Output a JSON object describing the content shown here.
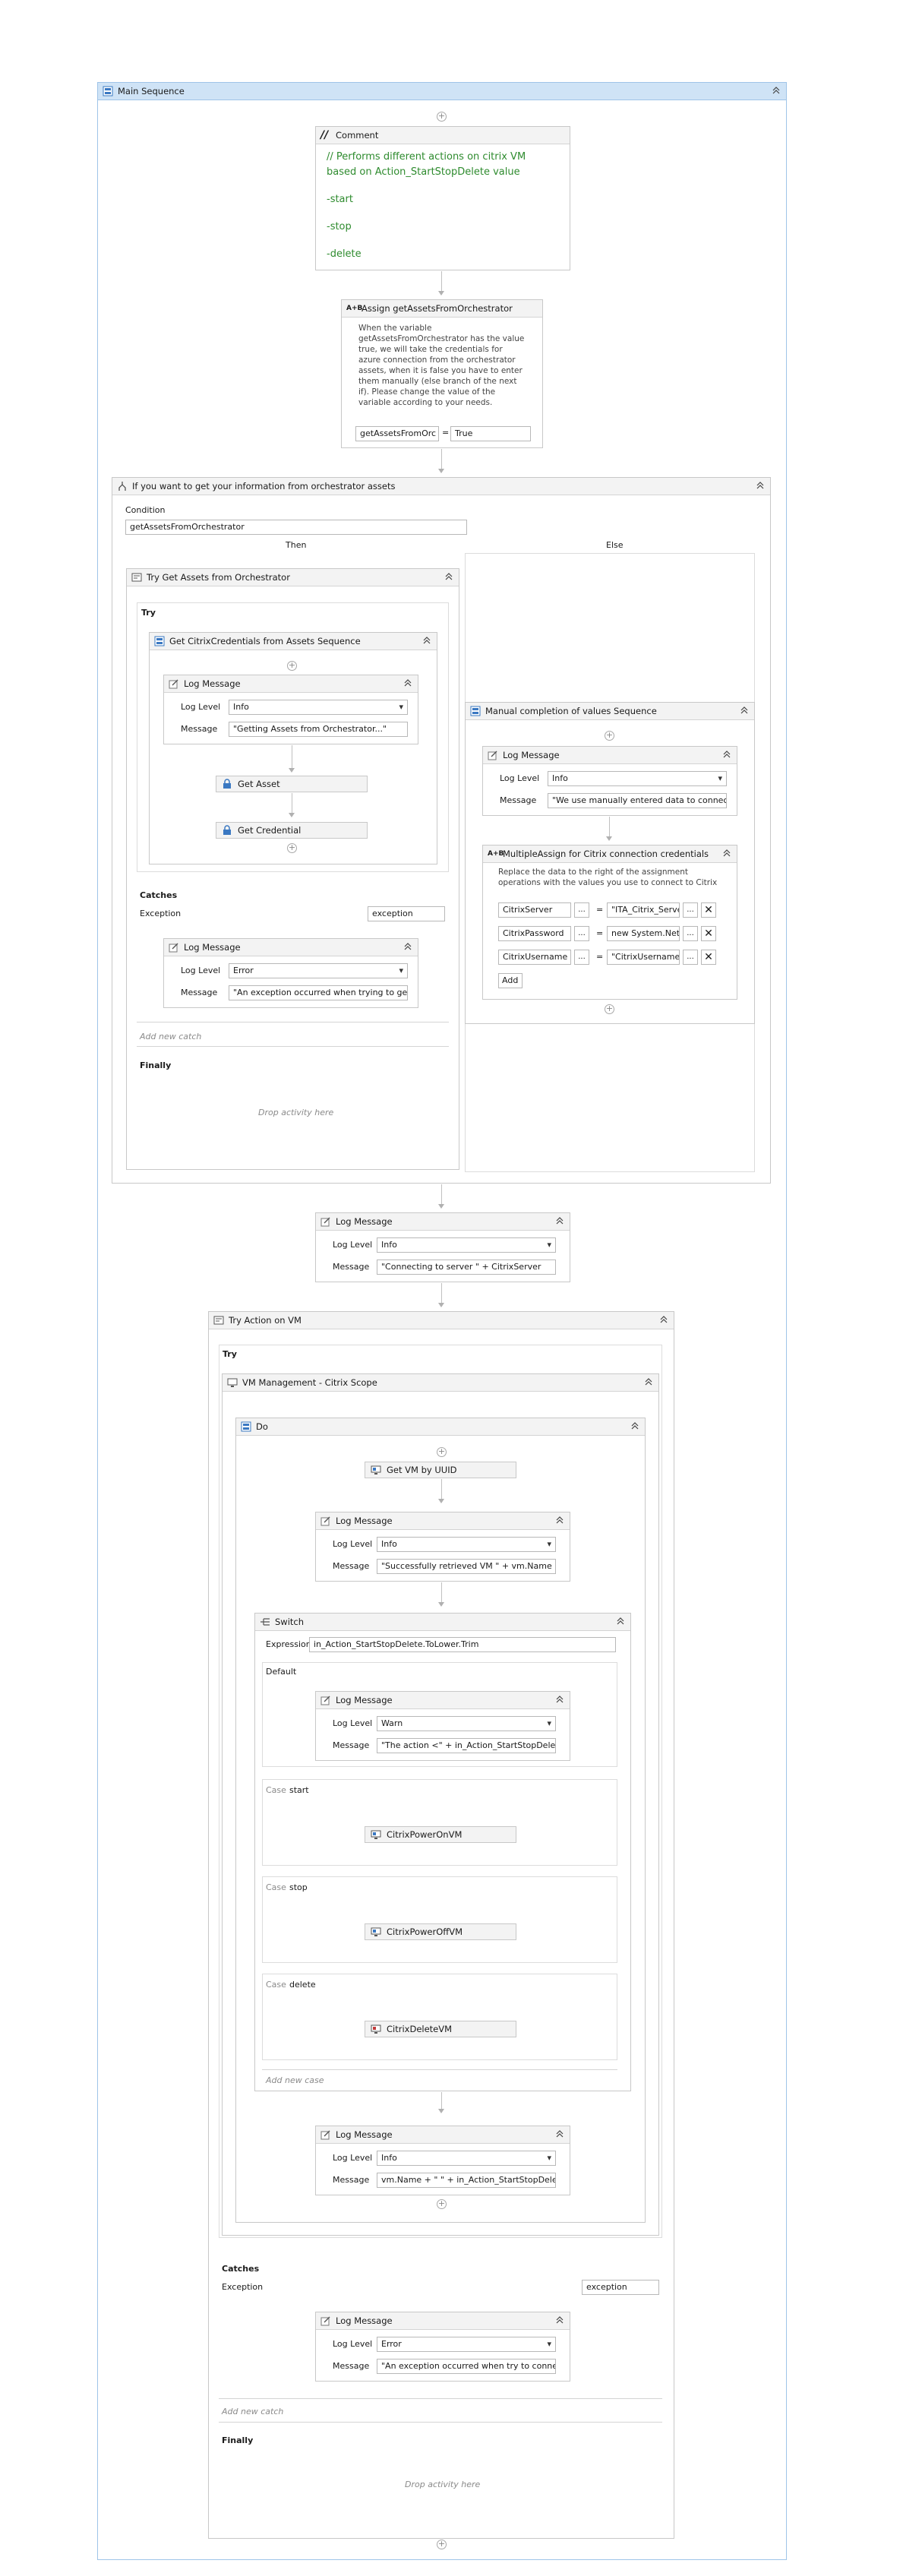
{
  "main": {
    "title": "Main Sequence"
  },
  "comment": {
    "title": "Comment",
    "lines": [
      "// Performs different actions on citrix VM",
      "based on Action_StartStopDelete value",
      "-start",
      "-stop",
      "-delete"
    ]
  },
  "assign": {
    "title": "Assign getAssetsFromOrchestrator",
    "description": "When the variable getAssetsFromOrchestrator has the value true, we will take the credentials for azure connection from the orchestrator assets, when it is false you have to enter them manually (else branch of the next if). Please change the value of the variable according to your needs.",
    "to": "getAssetsFromOrc",
    "op": "=",
    "value": "True"
  },
  "if": {
    "title": "If you want to get your information from orchestrator assets",
    "condition_label": "Condition",
    "condition": "getAssetsFromOrchestrator",
    "then_label": "Then",
    "else_label": "Else"
  },
  "try1": {
    "title": "Try Get Assets from Orchestrator",
    "try_label": "Try",
    "seq_title": "Get CitrixCredentials from Assets Sequence",
    "log": {
      "title": "Log Message",
      "level_label": "Log Level",
      "level": "Info",
      "message_label": "Message",
      "message": "\"Getting Assets from Orchestrator...\""
    },
    "get_asset": "Get Asset",
    "get_credential": "Get Credential",
    "catches_label": "Catches",
    "exception_label": "Exception",
    "exception_value": "exception",
    "catch_log": {
      "title": "Log Message",
      "level_label": "Log Level",
      "level": "Error",
      "message_label": "Message",
      "message": "\"An exception occurred when trying to get"
    },
    "add_catch": "Add new catch",
    "finally_label": "Finally",
    "drop_here": "Drop activity here"
  },
  "else_seq": {
    "title": "Manual completion of values Sequence",
    "log": {
      "title": "Log Message",
      "level_label": "Log Level",
      "level": "Info",
      "message_label": "Message",
      "message": "\"We use manually entered data to connect"
    },
    "multi": {
      "title": "MultipleAssign for  Citrix connection credentials",
      "description": "Replace the data to the right of the assignment operations with the values you use to connect to Citrix",
      "rows": [
        {
          "to": "CitrixServer",
          "value": "\"ITA_Citrix_Serve"
        },
        {
          "to": "CitrixPassword",
          "value": "new System.Net"
        },
        {
          "to": "CitrixUsername",
          "value": "\"CitrixUsername"
        }
      ],
      "dots": "...",
      "eq": "=",
      "add": "Add"
    }
  },
  "log_connect": {
    "title": "Log Message",
    "level_label": "Log Level",
    "level": "Info",
    "message_label": "Message",
    "message": "\"Connecting to server \" + CitrixServer"
  },
  "try2": {
    "title": "Try Action on VM",
    "try_label": "Try",
    "scope_title": "VM Management - Citrix Scope",
    "do_title": "Do",
    "get_vm": "Get VM by UUID",
    "log_retrieved": {
      "title": "Log Message",
      "level_label": "Log Level",
      "level": "Info",
      "message_label": "Message",
      "message": "\"Successfully retrieved VM \" + vm.Name +"
    },
    "switch": {
      "title": "Switch",
      "expression_label": "Expression",
      "expression": "in_Action_StartStopDelete.ToLower.Trim",
      "default_label": "Default",
      "default_log": {
        "title": "Log Message",
        "level_label": "Log Level",
        "level": "Warn",
        "message_label": "Message",
        "message": "\"The action <\" + in_Action_StartStopDelete"
      },
      "case_word": "Case",
      "cases": [
        {
          "name": "start",
          "activity": "CitrixPowerOnVM"
        },
        {
          "name": "stop",
          "activity": "CitrixPowerOffVM"
        },
        {
          "name": "delete",
          "activity": "CitrixDeleteVM"
        }
      ],
      "add_case": "Add new case"
    },
    "log_final": {
      "title": "Log Message",
      "level_label": "Log Level",
      "level": "Info",
      "message_label": "Message",
      "message": "vm.Name + \" \" + in_Action_StartStopDelet"
    },
    "catches_label": "Catches",
    "exception_label": "Exception",
    "exception_value": "exception",
    "catch_log": {
      "title": "Log Message",
      "level_label": "Log Level",
      "level": "Error",
      "message_label": "Message",
      "message": "\"An exception occurred when try to conne"
    },
    "add_catch": "Add new catch",
    "finally_label": "Finally",
    "drop_here": "Drop activity here"
  },
  "icons": {
    "sequence": "sequence-icon",
    "comment": "comment-icon",
    "assign": "assign-icon",
    "if": "if-icon",
    "try": "try-catch-icon",
    "log": "log-message-icon",
    "asset": "lock-icon",
    "vm": "vm-icon",
    "switch": "switch-icon",
    "collapse": "collapse-icon",
    "add": "plus-icon"
  },
  "colors": {
    "header_blue": "#cfe3f6",
    "comment_green": "#2e8b2e",
    "border": "#c8c8c8"
  }
}
